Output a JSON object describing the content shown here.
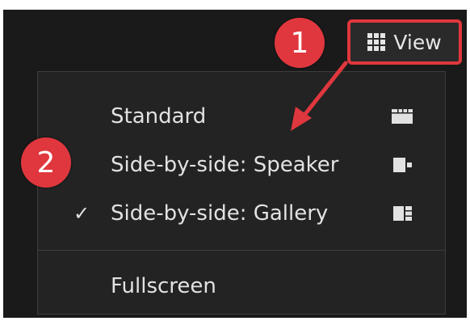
{
  "header": {
    "view_button_label": "View"
  },
  "annotations": {
    "step1": "1",
    "step2": "2"
  },
  "menu": {
    "items": [
      {
        "label": "Standard",
        "checked": false,
        "icon": "standard-layout-icon"
      },
      {
        "label": "Side-by-side: Speaker",
        "checked": false,
        "icon": "speaker-layout-icon"
      },
      {
        "label": "Side-by-side: Gallery",
        "checked": true,
        "icon": "gallery-layout-icon"
      },
      {
        "label": "Fullscreen",
        "checked": false,
        "icon": ""
      }
    ],
    "check_mark": "✓"
  },
  "colors": {
    "annotation_red": "#e0373e",
    "background": "#1a1a1a",
    "menu_background": "#232323",
    "text": "#e2e2e2"
  }
}
